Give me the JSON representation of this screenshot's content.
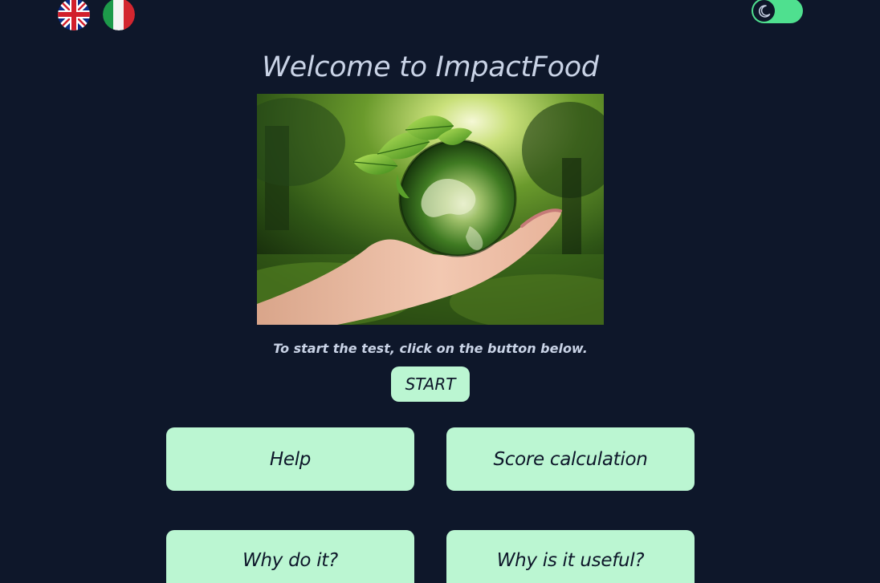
{
  "languages": [
    {
      "code": "en",
      "icon": "uk-flag-icon"
    },
    {
      "code": "it",
      "icon": "italy-flag-icon"
    }
  ],
  "theme_toggle": {
    "icon": "moon-icon",
    "state": "dark",
    "accent_color": "#4fe08f"
  },
  "header": {
    "title": "Welcome to ImpactFood"
  },
  "hero_image": {
    "icon": "hand-holding-earth-image"
  },
  "intro": {
    "instruction": "To start the test, click on the button below."
  },
  "start_button": {
    "label": "START"
  },
  "menu": {
    "help_label": "Help",
    "score_label": "Score calculation",
    "why_label": "Why do it?",
    "useful_label": "Why is it useful?"
  },
  "colors": {
    "background": "#0e172a",
    "button_background": "#bbf6d2",
    "text": "#c9d3e6",
    "button_text": "#0e172a"
  }
}
